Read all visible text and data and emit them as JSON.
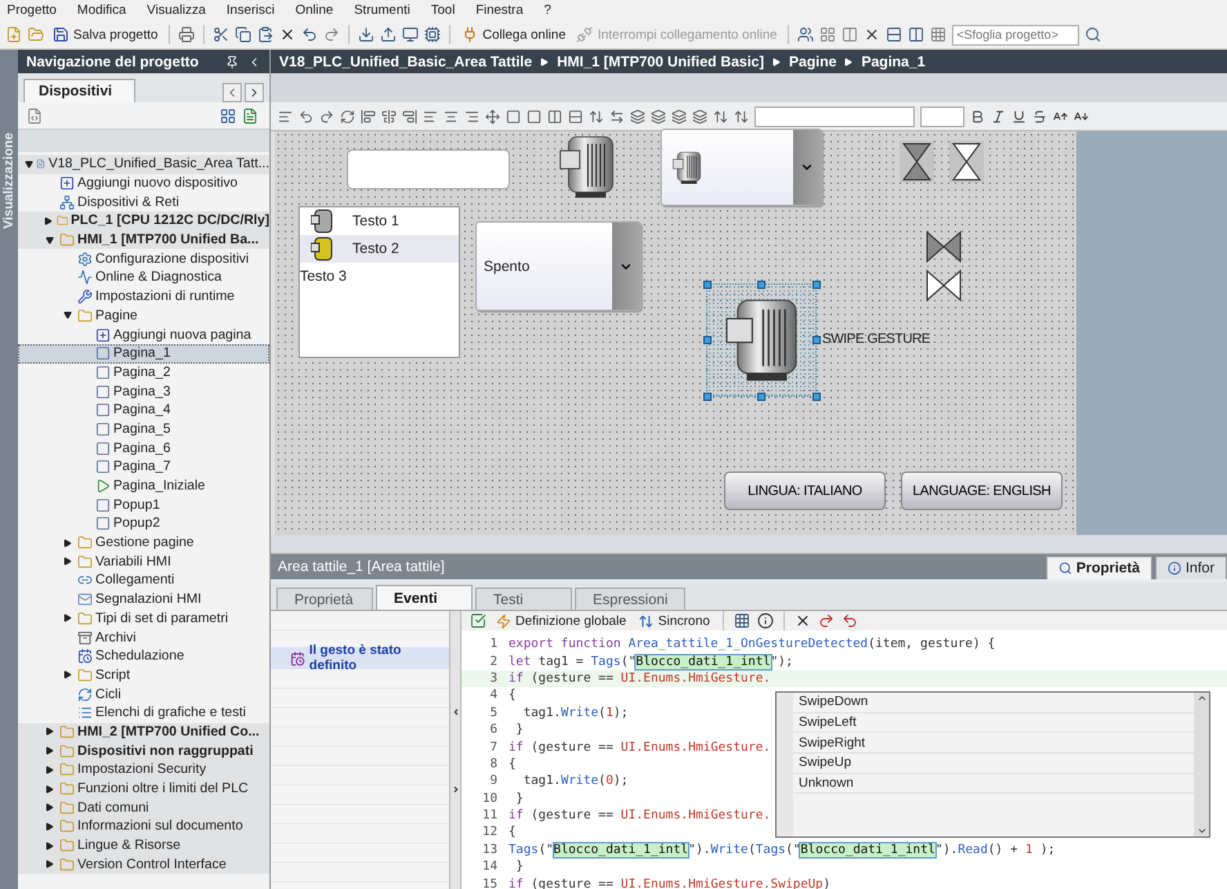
{
  "menu": [
    "Progetto",
    "Modifica",
    "Visualizza",
    "Inserisci",
    "Online",
    "Strumenti",
    "Tool",
    "Finestra",
    "?"
  ],
  "toolbar": {
    "save": "Salva progetto",
    "go_online": {
      "label": "Collega online",
      "disabled": false
    },
    "go_offline": {
      "label": "Interrompi collegamento online",
      "disabled": true
    },
    "search": {
      "placeholder": "<Sfoglia progetto>"
    }
  },
  "side_strip": {
    "label": "Visualizzazione"
  },
  "project_nav": {
    "title": "Navigazione del progetto",
    "tab": "Dispositivi",
    "tree": [
      {
        "label": "V18_PLC_Unified_Basic_Area Tatt...",
        "kind": "project",
        "expanded": true,
        "selected": false,
        "children": [
          {
            "label": "Aggiungi nuovo dispositivo",
            "kind": "add",
            "selected": false
          },
          {
            "label": "Dispositivi & Reti",
            "kind": "network",
            "selected": false
          },
          {
            "label": "PLC_1 [CPU 1212C DC/DC/Rly]",
            "kind": "device",
            "expanded": false,
            "selected": false
          },
          {
            "label": "HMI_1 [MTP700 Unified Ba...",
            "kind": "device",
            "expanded": true,
            "selected": false,
            "children": [
              {
                "label": "Configurazione dispositivi",
                "kind": "config",
                "selected": false
              },
              {
                "label": "Online & Diagnostica",
                "kind": "diagnostics",
                "selected": false
              },
              {
                "label": "Impostazioni di runtime",
                "kind": "runtime",
                "selected": false
              },
              {
                "label": "Pagine",
                "kind": "folder",
                "expanded": true,
                "selected": false,
                "children": [
                  {
                    "label": "Aggiungi nuova pagina",
                    "kind": "add",
                    "selected": false
                  },
                  {
                    "label": "Pagina_1",
                    "kind": "page",
                    "selected": true
                  },
                  {
                    "label": "Pagina_2",
                    "kind": "page",
                    "selected": false
                  },
                  {
                    "label": "Pagina_3",
                    "kind": "page",
                    "selected": false
                  },
                  {
                    "label": "Pagina_4",
                    "kind": "page",
                    "selected": false
                  },
                  {
                    "label": "Pagina_5",
                    "kind": "page",
                    "selected": false
                  },
                  {
                    "label": "Pagina_6",
                    "kind": "page",
                    "selected": false
                  },
                  {
                    "label": "Pagina_7",
                    "kind": "page",
                    "selected": false
                  },
                  {
                    "label": "Pagina_Iniziale",
                    "kind": "start",
                    "selected": false
                  },
                  {
                    "label": "Popup1",
                    "kind": "page",
                    "selected": false
                  },
                  {
                    "label": "Popup2",
                    "kind": "page",
                    "selected": false
                  }
                ]
              },
              {
                "label": "Gestione pagine",
                "kind": "folder",
                "expanded": false,
                "selected": false
              },
              {
                "label": "Variabili HMI",
                "kind": "folder",
                "expanded": false,
                "selected": false
              },
              {
                "label": "Collegamenti",
                "kind": "connections",
                "selected": false
              },
              {
                "label": "Segnalazioni HMI",
                "kind": "alarms",
                "selected": false
              },
              {
                "label": "Tipi di set di parametri",
                "kind": "folder",
                "expanded": false,
                "selected": false
              },
              {
                "label": "Archivi",
                "kind": "archive",
                "selected": false
              },
              {
                "label": "Schedulazione",
                "kind": "schedule",
                "selected": false
              },
              {
                "label": "Script",
                "kind": "folder",
                "expanded": false,
                "selected": false
              },
              {
                "label": "Cicli",
                "kind": "cycle",
                "selected": false
              },
              {
                "label": "Elenchi di grafiche e testi",
                "kind": "list",
                "selected": false
              }
            ]
          },
          {
            "label": "HMI_2 [MTP700 Unified Co...",
            "kind": "device",
            "expanded": false,
            "selected": false
          },
          {
            "label": "Dispositivi non raggruppati",
            "kind": "device",
            "expanded": false,
            "selected": false
          },
          {
            "label": "Impostazioni Security",
            "kind": "group",
            "expanded": false,
            "selected": false
          },
          {
            "label": "Funzioni oltre i limiti del PLC",
            "kind": "group",
            "expanded": false,
            "selected": false
          },
          {
            "label": "Dati comuni",
            "kind": "group",
            "expanded": false,
            "selected": false
          },
          {
            "label": "Informazioni sul documento",
            "kind": "group",
            "expanded": false,
            "selected": false
          },
          {
            "label": "Lingue & Risorse",
            "kind": "group",
            "expanded": false,
            "selected": false
          },
          {
            "label": "Version Control Interface",
            "kind": "group",
            "expanded": false,
            "selected": false
          }
        ]
      }
    ]
  },
  "breadcrumb": [
    "V18_PLC_Unified_Basic_Area Tattile",
    "HMI_1 [MTP700 Unified Basic]",
    "Pagine",
    "Pagina_1"
  ],
  "canvas": {
    "list_box": [
      {
        "label": "Testo 1",
        "kind": "off",
        "selected": false
      },
      {
        "label": "Testo 2",
        "kind": "on",
        "selected": true
      },
      {
        "label": "Testo 3",
        "kind": "plain",
        "selected": false
      }
    ],
    "combo": {
      "value": "Spento"
    },
    "gesture_label": "SWIPE GESTURE",
    "buttons": [
      "LINGUA: ITALIANO",
      "LANGUAGE: ENGLISH"
    ]
  },
  "inspector": {
    "title": "Area tattile_1 [Area tattile]",
    "side_tabs": [
      {
        "label": "Proprietà",
        "selected": true
      },
      {
        "label": "Infor",
        "selected": false
      }
    ],
    "tabs": [
      {
        "label": "Proprietà",
        "selected": false
      },
      {
        "label": "Eventi",
        "selected": true
      },
      {
        "label": "Testi",
        "selected": false
      },
      {
        "label": "Espressioni",
        "selected": false
      }
    ],
    "events": [
      {
        "label": "Il gesto è stato definito",
        "selected": true
      }
    ],
    "code_toolbar": {
      "global": "Definizione globale",
      "sync": "Sincrono"
    },
    "code": [
      {
        "number": "1",
        "tokens": [
          {
            "kind": "kw",
            "text": "export function "
          },
          {
            "kind": "fn",
            "text": "Area_tattile_1_OnGestureDetected"
          },
          {
            "kind": "plain",
            "text": "(item, gesture) {"
          }
        ]
      },
      {
        "number": "2",
        "tokens": [
          {
            "kind": "kw",
            "text": "let "
          },
          {
            "kind": "plain",
            "text": "tag1 = "
          },
          {
            "kind": "fn",
            "text": "Tags"
          },
          {
            "kind": "plain",
            "text": "(\""
          },
          {
            "kind": "str",
            "text": "Blocco_dati_1_intl"
          },
          {
            "kind": "plain",
            "text": "\");"
          }
        ]
      },
      {
        "number": "3",
        "tokens": [
          {
            "kind": "kw",
            "text": "if"
          },
          {
            "kind": "plain",
            "text": " (gesture == "
          },
          {
            "kind": "member",
            "text": "UI.Enums.HmiGesture."
          }
        ]
      },
      {
        "number": "4",
        "tokens": [
          {
            "kind": "plain",
            "text": "{"
          }
        ]
      },
      {
        "number": "5",
        "tokens": [
          {
            "kind": "plain",
            "text": "  tag1."
          },
          {
            "kind": "fn",
            "text": "Write"
          },
          {
            "kind": "plain",
            "text": "("
          },
          {
            "kind": "num",
            "text": "1"
          },
          {
            "kind": "plain",
            "text": ");"
          }
        ]
      },
      {
        "number": "6",
        "tokens": [
          {
            "kind": "plain",
            "text": " }"
          }
        ]
      },
      {
        "number": "7",
        "tokens": [
          {
            "kind": "kw",
            "text": "if"
          },
          {
            "kind": "plain",
            "text": " (gesture == "
          },
          {
            "kind": "member",
            "text": "UI.Enums.HmiGesture."
          }
        ]
      },
      {
        "number": "8",
        "tokens": [
          {
            "kind": "plain",
            "text": "{"
          }
        ]
      },
      {
        "number": "9",
        "tokens": [
          {
            "kind": "plain",
            "text": "  tag1."
          },
          {
            "kind": "fn",
            "text": "Write"
          },
          {
            "kind": "plain",
            "text": "("
          },
          {
            "kind": "num",
            "text": "0"
          },
          {
            "kind": "plain",
            "text": ");"
          }
        ]
      },
      {
        "number": "10",
        "tokens": [
          {
            "kind": "plain",
            "text": " }"
          }
        ]
      },
      {
        "number": "11",
        "tokens": [
          {
            "kind": "kw",
            "text": "if"
          },
          {
            "kind": "plain",
            "text": " (gesture == "
          },
          {
            "kind": "member",
            "text": "UI.Enums.HmiGesture."
          }
        ]
      },
      {
        "number": "12",
        "tokens": [
          {
            "kind": "plain",
            "text": "{"
          }
        ]
      },
      {
        "number": "13",
        "tokens": [
          {
            "kind": "fn",
            "text": "Tags"
          },
          {
            "kind": "plain",
            "text": "(\""
          },
          {
            "kind": "str",
            "text": "Blocco_dati_1_intl"
          },
          {
            "kind": "plain",
            "text": "\")."
          },
          {
            "kind": "fn",
            "text": "Write"
          },
          {
            "kind": "plain",
            "text": "("
          },
          {
            "kind": "fn",
            "text": "Tags"
          },
          {
            "kind": "plain",
            "text": "(\""
          },
          {
            "kind": "str",
            "text": "Blocco_dati_1_intl"
          },
          {
            "kind": "plain",
            "text": "\")."
          },
          {
            "kind": "fn",
            "text": "Read"
          },
          {
            "kind": "plain",
            "text": "() + "
          },
          {
            "kind": "num",
            "text": "1"
          },
          {
            "kind": "plain",
            "text": " );"
          }
        ]
      },
      {
        "number": "14",
        "tokens": [
          {
            "kind": "plain",
            "text": " }"
          }
        ]
      },
      {
        "number": "15",
        "tokens": [
          {
            "kind": "kw",
            "text": "if"
          },
          {
            "kind": "plain",
            "text": " (gesture == "
          },
          {
            "kind": "member",
            "text": "UI.Enums.HmiGesture.SwipeUp"
          },
          {
            "kind": "plain",
            "text": ")"
          }
        ]
      }
    ],
    "autocomplete": [
      {
        "label": "SwipeDown",
        "selected": false
      },
      {
        "label": "SwipeLeft",
        "selected": false
      },
      {
        "label": "SwipeRight",
        "selected": false
      },
      {
        "label": "SwipeUp",
        "selected": false
      },
      {
        "label": "Unknown",
        "selected": false
      }
    ]
  }
}
